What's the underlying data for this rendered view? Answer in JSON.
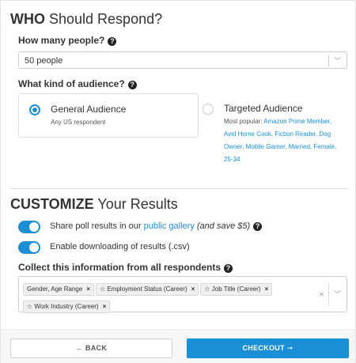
{
  "respond": {
    "title_bold": "WHO",
    "title_rest": " Should Respond?",
    "count_label": "How many people?",
    "count_value": "50 people",
    "audience_label": "What kind of audience?",
    "general_title": "General Audience",
    "general_sub": "Any US respondent",
    "targeted_title": "Targeted Audience",
    "popular_prefix": "Most popular: ",
    "popular_items": "Amazon Prime Member, Avid Home Cook, Fiction Reader, Dog Owner, Mobile Gamer, Married, Female, 25-34"
  },
  "customize": {
    "title_bold": "CUSTOMIZE",
    "title_rest": " Your Results",
    "share_prefix": "Share poll results in our ",
    "share_link": "public gallery",
    "share_suffix": "(and save $5)",
    "download_label": "Enable downloading of results (.csv)",
    "collect_label": "Collect this information from all respondents",
    "tags": [
      "Gender, Age Range",
      "☆ Employment Status (Career)",
      "☆ Job Title (Career)",
      "☆ Work Industry (Career)"
    ]
  },
  "footer": {
    "back_label": "← BACK",
    "checkout_label": "CHECKOUT ➞"
  },
  "colors": {
    "accent": "#1a8fd6"
  },
  "icons": {
    "help": "question-circle-icon",
    "dropdown": "chevron-down-icon",
    "tag_remove": "close-icon",
    "clear": "clear-icon",
    "star": "star-icon"
  }
}
